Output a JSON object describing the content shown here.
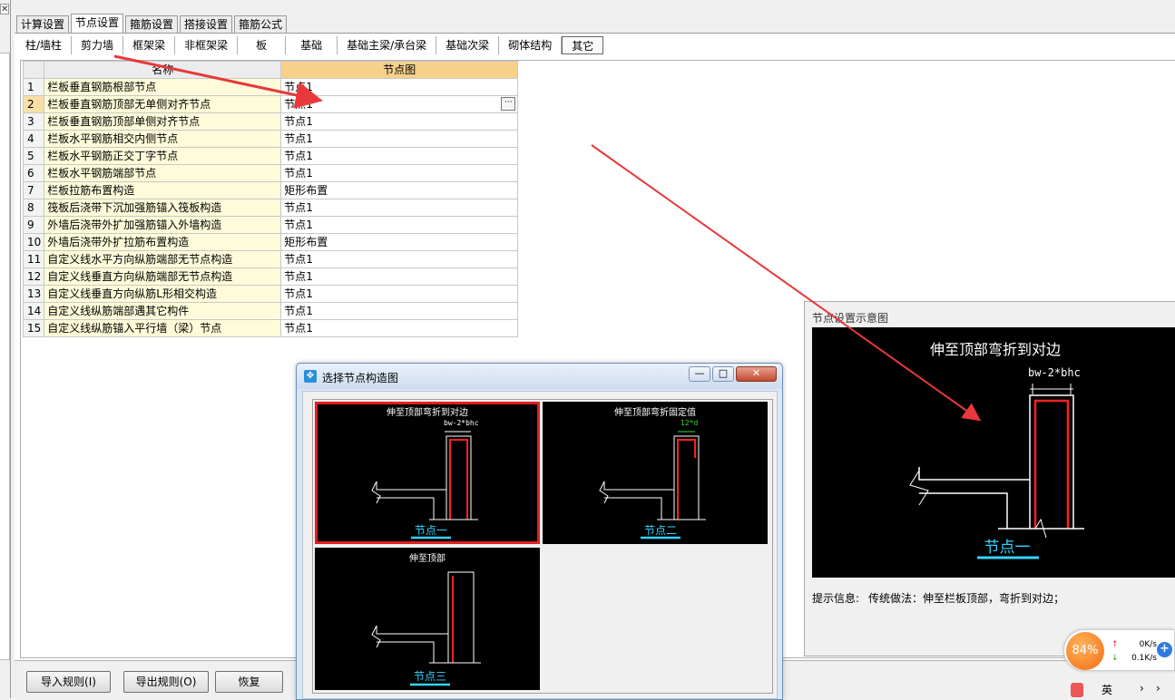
{
  "main_tabs": [
    "计算设置",
    "节点设置",
    "箍筋设置",
    "搭接设置",
    "箍筋公式"
  ],
  "main_tab_active": 1,
  "sub_tabs": [
    "柱/墙柱",
    "剪力墙",
    "框架梁",
    "非框架梁",
    "板",
    "基础",
    "基础主梁/承台梁",
    "基础次梁",
    "砌体结构",
    "其它"
  ],
  "sub_tab_active": 9,
  "table": {
    "headers": {
      "name": "名称",
      "pic": "节点图"
    },
    "rows": [
      {
        "idx": "1",
        "name": "栏板垂直钢筋根部节点",
        "pic": "节点1"
      },
      {
        "idx": "2",
        "name": "栏板垂直钢筋顶部无单侧对齐节点",
        "pic": "节点1",
        "selected": true,
        "ellipsis": "···"
      },
      {
        "idx": "3",
        "name": "栏板垂直钢筋顶部单侧对齐节点",
        "pic": "节点1"
      },
      {
        "idx": "4",
        "name": "栏板水平钢筋相交内侧节点",
        "pic": "节点1"
      },
      {
        "idx": "5",
        "name": "栏板水平钢筋正交丁字节点",
        "pic": "节点1"
      },
      {
        "idx": "6",
        "name": "栏板水平钢筋端部节点",
        "pic": "节点1"
      },
      {
        "idx": "7",
        "name": "栏板拉筋布置构造",
        "pic": "矩形布置"
      },
      {
        "idx": "8",
        "name": "筏板后浇带下沉加强筋锚入筏板构造",
        "pic": "节点1"
      },
      {
        "idx": "9",
        "name": "外墙后浇带外扩加强筋锚入外墙构造",
        "pic": "节点1"
      },
      {
        "idx": "10",
        "name": "外墙后浇带外扩拉筋布置构造",
        "pic": "矩形布置"
      },
      {
        "idx": "11",
        "name": "自定义线水平方向纵筋端部无节点构造",
        "pic": "节点1"
      },
      {
        "idx": "12",
        "name": "自定义线垂直方向纵筋端部无节点构造",
        "pic": "节点1"
      },
      {
        "idx": "13",
        "name": "自定义线垂直方向纵筋L形相交构造",
        "pic": "节点1"
      },
      {
        "idx": "14",
        "name": "自定义线纵筋端部遇其它构件",
        "pic": "节点1"
      },
      {
        "idx": "15",
        "name": "自定义线纵筋锚入平行墙（梁）节点",
        "pic": "节点1"
      }
    ]
  },
  "buttons": {
    "import": "导入规则(I)",
    "export": "导出规则(O)",
    "restore": "恢复"
  },
  "preview": {
    "title": "节点设置示意图",
    "diagram_title": "伸至顶部弯折到对边",
    "dimension": "bw-2*bhc",
    "node_label": "节点一",
    "hint_label": "提示信息:",
    "hint_text": "传统做法：伸至栏板顶部，弯折到对边；"
  },
  "dialog": {
    "title": "选择节点构造图",
    "win_buttons": [
      "—",
      "□",
      "✕"
    ],
    "options": [
      {
        "title": "伸至顶部弯折到对边",
        "dim": "bw-2*bhc",
        "label": "节点一",
        "selected": true
      },
      {
        "title": "伸至顶部弯折固定值",
        "dim": "12*d",
        "label": "节点二",
        "selected": false
      },
      {
        "title": "伸至顶部",
        "dim": "",
        "label": "节点三",
        "selected": false
      }
    ]
  },
  "net_widget": {
    "percent": "84%",
    "up": "0K/s",
    "down": "0.1K/s",
    "plus": "+"
  },
  "left_close": "✕",
  "tray": [
    "英"
  ],
  "colors": {
    "annotation_arrow": "#e8383c",
    "rebar": "#ff2020",
    "node_label": "#35d5ff",
    "selected_row": "#f9dfa6",
    "name_cell": "#fdfbd9"
  }
}
